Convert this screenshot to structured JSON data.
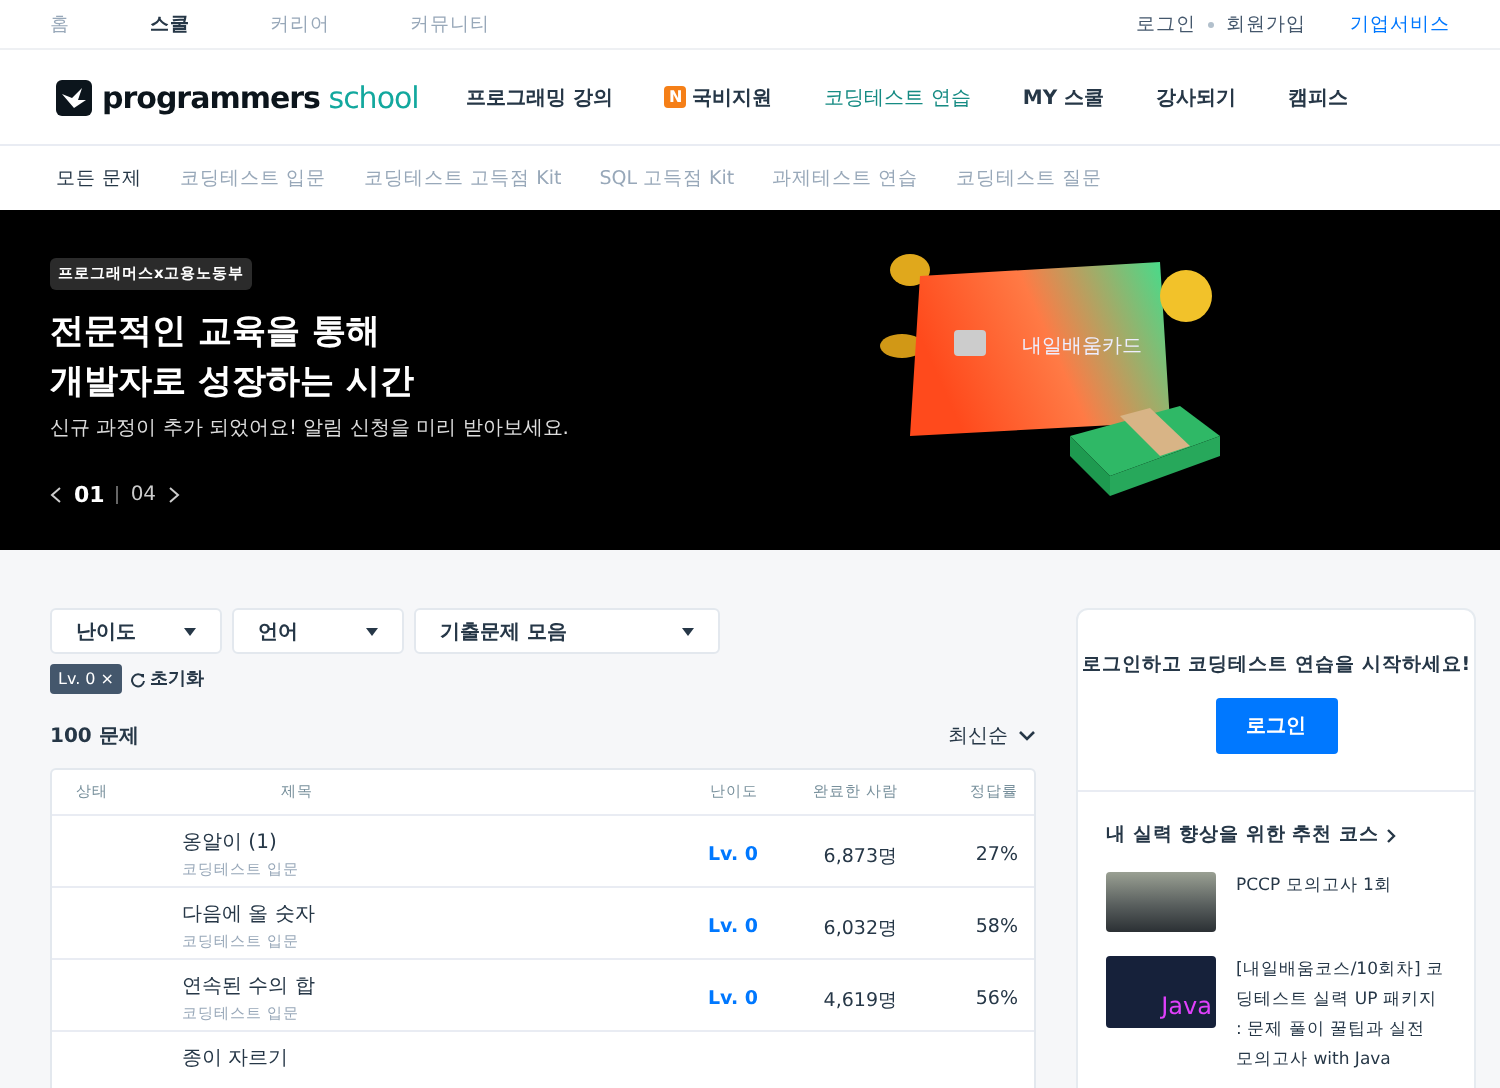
{
  "top_nav": {
    "items": [
      {
        "label": "홈",
        "selected": false
      },
      {
        "label": "스쿨",
        "selected": true
      },
      {
        "label": "커리어",
        "selected": false
      },
      {
        "label": "커뮤니티",
        "selected": false
      }
    ],
    "links": [
      "로그인",
      "회원가입"
    ],
    "business_link": "기업서비스"
  },
  "header": {
    "logo_word": "programmers",
    "logo_suffix": "school",
    "menu": [
      {
        "label": "프로그래밍 강의",
        "selected": false
      },
      {
        "label": "국비지원",
        "badge": "N",
        "selected": false
      },
      {
        "label": "코딩테스트 연습",
        "selected": true
      },
      {
        "label": "MY 스쿨",
        "selected": false
      },
      {
        "label": "강사되기",
        "selected": false
      },
      {
        "label": "캠피스",
        "selected": false
      }
    ]
  },
  "sub_nav": [
    {
      "label": "모든 문제",
      "selected": true
    },
    {
      "label": "코딩테스트 입문",
      "selected": false
    },
    {
      "label": "코딩테스트 고득점 Kit",
      "selected": false
    },
    {
      "label": "SQL 고득점 Kit",
      "selected": false
    },
    {
      "label": "과제테스트 연습",
      "selected": false
    },
    {
      "label": "코딩테스트 질문",
      "selected": false
    }
  ],
  "banner": {
    "tag": "프로그래머스x고용노동부",
    "title_lines": [
      "전문적인 교육을 통해",
      "개발자로 성장하는 시간"
    ],
    "subtitle": "신규 과정이 추가 되었어요! 알림 신청을 미리 받아보세요.",
    "page_current": "01",
    "page_total": "04",
    "card_text": "내일배움카드"
  },
  "filters": [
    {
      "label": "난이도"
    },
    {
      "label": "언어"
    },
    {
      "label": "기출문제 모음"
    }
  ],
  "active_filters": [
    {
      "label": "Lv. 0",
      "remove": "×"
    }
  ],
  "reset_label": "초기화",
  "count": "100 문제",
  "sort": "최신순",
  "table": {
    "columns": [
      "상태",
      "제목",
      "난이도",
      "완료한 사람",
      "정답률"
    ],
    "rows": [
      {
        "title": "옹알이 (1)",
        "category": "코딩테스트 입문",
        "level": "Lv. 0",
        "solved": "6,873명",
        "rate": "27%"
      },
      {
        "title": "다음에 올 숫자",
        "category": "코딩테스트 입문",
        "level": "Lv. 0",
        "solved": "6,032명",
        "rate": "58%"
      },
      {
        "title": "연속된 수의 합",
        "category": "코딩테스트 입문",
        "level": "Lv. 0",
        "solved": "4,619명",
        "rate": "56%"
      },
      {
        "title": "종이 자르기"
      }
    ]
  },
  "sidebar": {
    "prompt": "로그인하고 코딩테스트 연습을 시작하세요!",
    "login_button": "로그인",
    "recommend_title": "내 실력 향상을 위한 추천 코스",
    "courses": [
      {
        "title": "PCCP 모의고사 1회",
        "kind": "photo"
      },
      {
        "title": "[내일배움코스/10회차] 코딩테스트 실력 UP 패키지 : 문제 풀이 꿀팁과 실전 모의고사 with Java",
        "kind": "poster",
        "thumb_label": "Java"
      }
    ]
  }
}
